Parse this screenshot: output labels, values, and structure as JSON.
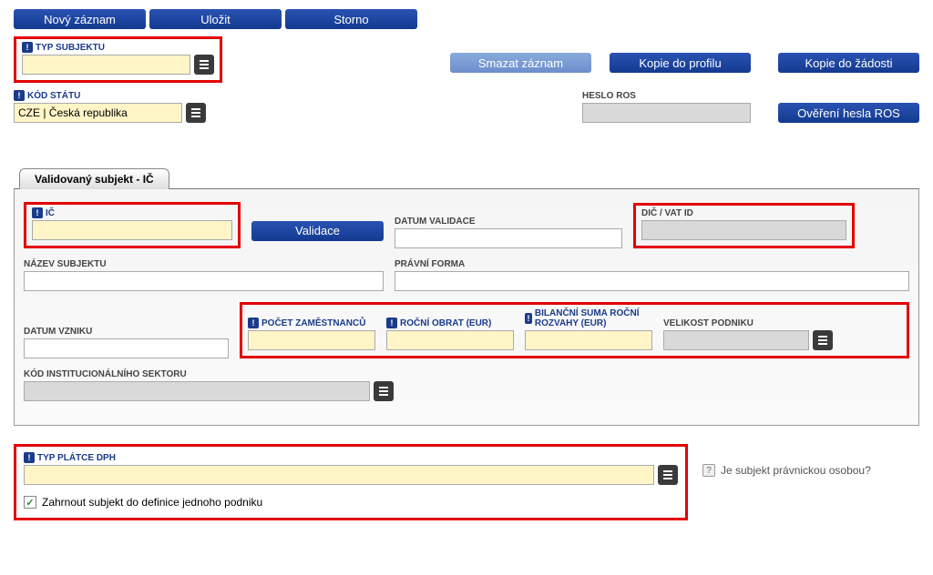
{
  "topButtons": {
    "new": "Nový záznam",
    "save": "Uložit",
    "cancel": "Storno"
  },
  "actionButtons": {
    "delete": "Smazat záznam",
    "copyProfile": "Kopie do profilu",
    "copyRequest": "Kopie do žádosti",
    "validate": "Validace",
    "verifyRos": "Ověření hesla ROS"
  },
  "labels": {
    "typSubjektu": "TYP SUBJEKTU",
    "kodStatu": "KÓD STÁTU",
    "hesloRos": "HESLO ROS",
    "ic": "IČ",
    "datumValidace": "DATUM VALIDACE",
    "dic": "DIČ / VAT ID",
    "nazevSubjektu": "NÁZEV SUBJEKTU",
    "pravniForma": "PRÁVNÍ FORMA",
    "datumVzniku": "DATUM VZNIKU",
    "pocetZamestnancu": "POČET ZAMĚSTNANCŮ",
    "rocniObrat": "ROČNÍ OBRAT (EUR)",
    "bilancniSuma": "BILANČNÍ SUMA ROČNÍ ROZVAHY (EUR)",
    "velikostPodniku": "VELIKOST PODNIKU",
    "kodSektoru": "KÓD INSTITUCIONÁLNÍHO SEKTORU",
    "typPlatceDph": "TYP PLÁTCE DPH",
    "pravnickaOsoba": "Je subjekt právnickou osobou?",
    "zahrnoutSubjekt": "Zahrnout subjekt do definice jednoho podniku"
  },
  "values": {
    "kodStatu": "CZE | Česká republika",
    "ic": "",
    "typSubjektu": "",
    "hesloRos": "",
    "datumValidace": "",
    "dic": "",
    "nazevSubjektu": "",
    "pravniForma": "",
    "datumVzniku": "",
    "pocetZamestnancu": "",
    "rocniObrat": "",
    "bilancniSuma": "",
    "velikostPodniku": "",
    "kodSektoru": "",
    "typPlatceDph": "",
    "zahrnoutChecked": true
  },
  "tab": {
    "validovany": "Validovaný subjekt - IČ"
  }
}
